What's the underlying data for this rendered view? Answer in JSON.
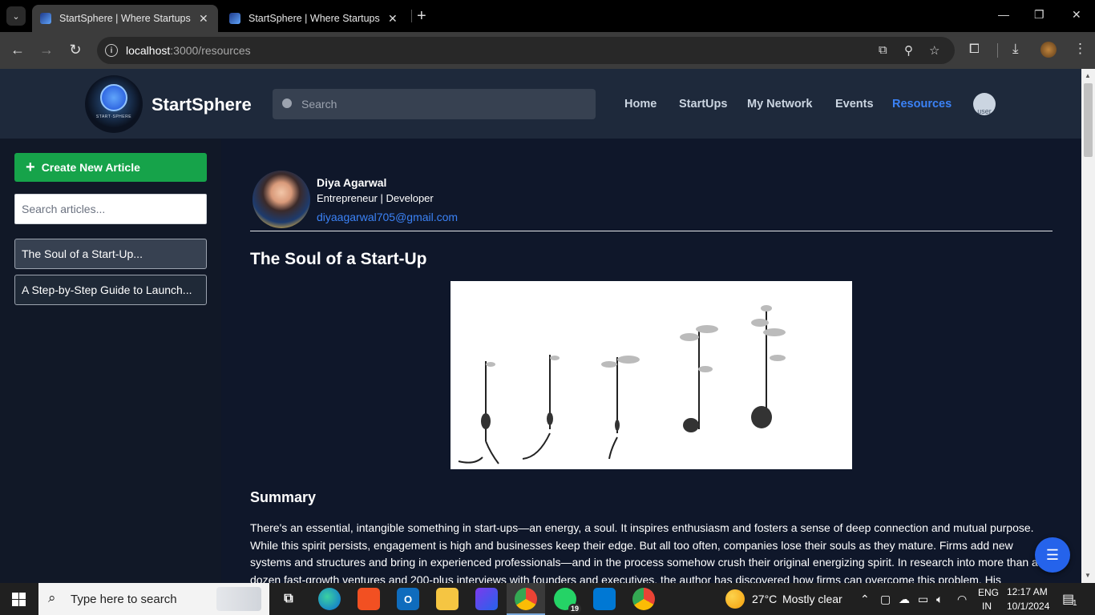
{
  "browser": {
    "tabs": [
      {
        "title": "StartSphere | Where Startups Take Flight"
      },
      {
        "title": "StartSphere | Where Startups Take Flight"
      }
    ],
    "url_host": "localhost",
    "url_path": ":3000/resources"
  },
  "header": {
    "logo_tag": "START·SPHERE",
    "brand": "StartSphere",
    "search_placeholder": "Search",
    "nav": [
      "Home",
      "StartUps",
      "My Network",
      "Events",
      "Resources"
    ],
    "active_nav": "Resources",
    "user_avatar_alt": "user"
  },
  "sidebar": {
    "create_label": "Create New Article",
    "search_placeholder": "Search articles...",
    "articles": [
      "The Soul of a Start-Up...",
      "A Step-by-Step Guide to Launch..."
    ]
  },
  "article": {
    "author_name": "Diya Agarwal",
    "author_role": "Entrepreneur | Developer",
    "author_email": "diyaagarwal705@gmail.com",
    "title": "The Soul of a Start-Up",
    "summary_heading": "Summary",
    "summary_text": "There's an essential, intangible something in start-ups—an energy, a soul. It inspires enthusiasm and fosters a sense of deep connection and mutual purpose. While this spirit persists, engagement is high and businesses keep their edge. But all too often, companies lose their souls as they mature. Firms add new systems and structures and bring in experienced professionals—and in the process somehow crush their original energizing spirit. In research into more than a dozen fast-growth ventures and 200-plus interviews with founders and executives, the author has discovered how firms can overcome this problem. His"
  },
  "taskbar": {
    "search_placeholder": "Type here to search",
    "whatsapp_badge": "19",
    "weather_temp": "27°C",
    "weather_text": "Mostly clear",
    "lang_top": "ENG",
    "lang_bottom": "IN",
    "time": "12:17 AM",
    "date": "10/1/2024",
    "notif_count": "1"
  }
}
